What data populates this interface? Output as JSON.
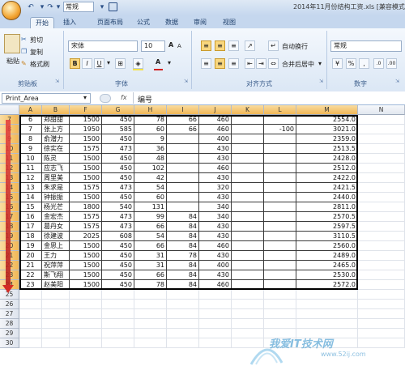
{
  "titlebar": {
    "title": "2014年11月份结构工资.xls  [兼容模式]",
    "qat_select": "常规"
  },
  "tabs": [
    "开始",
    "插入",
    "页面布局",
    "公式",
    "数据",
    "审阅",
    "视图"
  ],
  "ribbon": {
    "clipboard": {
      "paste": "粘贴",
      "cut": "剪切",
      "copy": "复制",
      "format_painter": "格式刷",
      "label": "剪贴板"
    },
    "font": {
      "name": "宋体",
      "size": "10",
      "bold": "B",
      "italic": "I",
      "underline": "U",
      "label": "字体",
      "font_color": "#d21f1f",
      "fill_color": "#f4e24a"
    },
    "alignment": {
      "wrap": "自动换行",
      "merge": "合并后居中",
      "label": "对齐方式"
    },
    "number": {
      "format": "常规",
      "label": "数字",
      "percent": "%",
      "comma": ",",
      "dec_inc": ".0",
      "dec_dec": ".00"
    }
  },
  "formula_bar": {
    "name_box": "Print_Area",
    "fx": "fx",
    "content": "编号"
  },
  "columns": [
    "",
    "A",
    "B",
    "F",
    "G",
    "H",
    "I",
    "J",
    "K",
    "L",
    "M",
    "N"
  ],
  "rows": [
    {
      "r": "7",
      "A": "6",
      "B": "郑甜甜",
      "F": "1500",
      "G": "450",
      "H": "78",
      "I": "66",
      "J": "460",
      "L": "",
      "M": "2554.0"
    },
    {
      "r": "8",
      "A": "7",
      "B": "张上方",
      "F": "1950",
      "G": "585",
      "H": "60",
      "I": "66",
      "J": "460",
      "L": "-100",
      "M": "3021.0"
    },
    {
      "r": "9",
      "A": "8",
      "B": "俞潜力",
      "F": "1500",
      "G": "450",
      "H": "9",
      "I": "",
      "J": "400",
      "L": "",
      "M": "2359.0"
    },
    {
      "r": "10",
      "A": "9",
      "B": "徐实在",
      "F": "1575",
      "G": "473",
      "H": "36",
      "I": "",
      "J": "430",
      "L": "",
      "M": "2513.5"
    },
    {
      "r": "11",
      "A": "10",
      "B": "陈灵",
      "F": "1500",
      "G": "450",
      "H": "48",
      "I": "",
      "J": "430",
      "L": "",
      "M": "2428.0"
    },
    {
      "r": "12",
      "A": "11",
      "B": "应志飞",
      "F": "1500",
      "G": "450",
      "H": "102",
      "I": "",
      "J": "460",
      "L": "",
      "M": "2512.0"
    },
    {
      "r": "13",
      "A": "12",
      "B": "周里美",
      "F": "1500",
      "G": "450",
      "H": "42",
      "I": "",
      "J": "430",
      "L": "",
      "M": "2422.0"
    },
    {
      "r": "14",
      "A": "13",
      "B": "朱求是",
      "F": "1575",
      "G": "473",
      "H": "54",
      "I": "",
      "J": "320",
      "L": "",
      "M": "2421.5"
    },
    {
      "r": "15",
      "A": "14",
      "B": "钟振振",
      "F": "1500",
      "G": "450",
      "H": "60",
      "I": "",
      "J": "430",
      "L": "",
      "M": "2440.0"
    },
    {
      "r": "16",
      "A": "15",
      "B": "杨光芒",
      "F": "1800",
      "G": "540",
      "H": "131",
      "I": "",
      "J": "340",
      "L": "",
      "M": "2811.0"
    },
    {
      "r": "17",
      "A": "16",
      "B": "金宏杰",
      "F": "1575",
      "G": "473",
      "H": "99",
      "I": "84",
      "J": "340",
      "L": "",
      "M": "2570.5"
    },
    {
      "r": "18",
      "A": "17",
      "B": "葛丹女",
      "F": "1575",
      "G": "473",
      "H": "66",
      "I": "84",
      "J": "430",
      "L": "",
      "M": "2597.5"
    },
    {
      "r": "19",
      "A": "18",
      "B": "徐建波",
      "F": "2025",
      "G": "608",
      "H": "54",
      "I": "84",
      "J": "430",
      "L": "",
      "M": "3110.5"
    },
    {
      "r": "20",
      "A": "19",
      "B": "金思上",
      "F": "1500",
      "G": "450",
      "H": "66",
      "I": "84",
      "J": "460",
      "L": "",
      "M": "2560.0"
    },
    {
      "r": "21",
      "A": "20",
      "B": "王力",
      "F": "1500",
      "G": "450",
      "H": "31",
      "I": "78",
      "J": "430",
      "L": "",
      "M": "2489.0"
    },
    {
      "r": "22",
      "A": "21",
      "B": "祝萍萍",
      "F": "1500",
      "G": "450",
      "H": "31",
      "I": "84",
      "J": "400",
      "L": "",
      "M": "2465.0"
    },
    {
      "r": "23",
      "A": "22",
      "B": "斯飞翔",
      "F": "1500",
      "G": "450",
      "H": "66",
      "I": "84",
      "J": "430",
      "L": "",
      "M": "2530.0"
    },
    {
      "r": "24",
      "A": "23",
      "B": "赵美阳",
      "F": "1500",
      "G": "450",
      "H": "78",
      "I": "84",
      "J": "460",
      "L": "",
      "M": "2572.0"
    }
  ],
  "empty_rows": [
    "25",
    "26",
    "27",
    "28",
    "29",
    "30"
  ],
  "watermark": {
    "text": "我爱IT技术网",
    "url": "www.52ij.com"
  }
}
